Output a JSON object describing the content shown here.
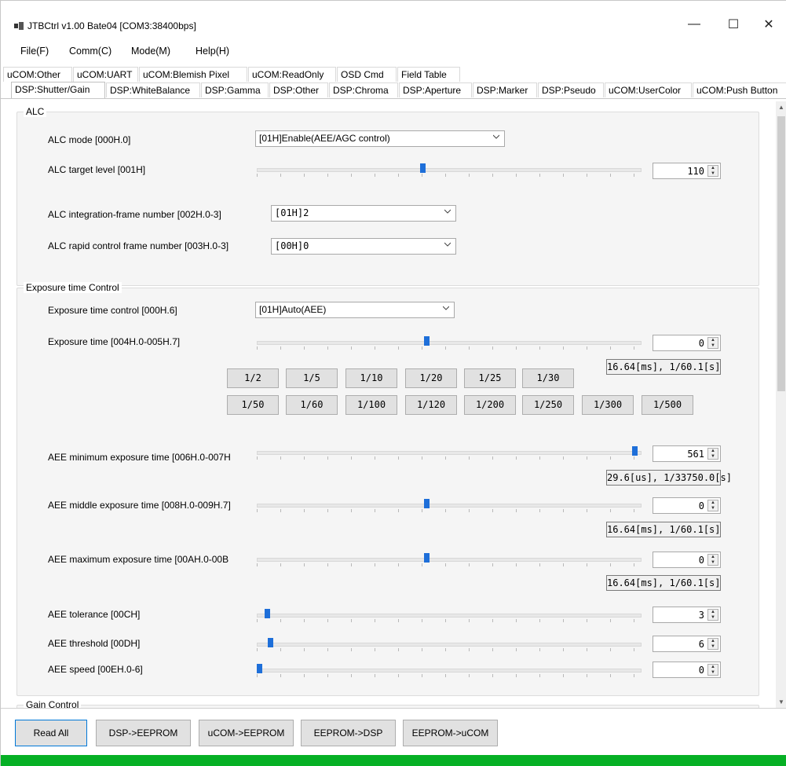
{
  "window": {
    "title": "JTBCtrl v1.00 Bate04 [COM3:38400bps]",
    "minimize": "—",
    "maximize": "☐",
    "close": "✕"
  },
  "menu": [
    {
      "label": "File(F)"
    },
    {
      "label": "Comm(C)"
    },
    {
      "label": "Mode(M)"
    },
    {
      "label": "Help(H)"
    }
  ],
  "tabs_row1": [
    "uCOM:Other",
    "uCOM:UART",
    "uCOM:Blemish Pixel",
    "uCOM:ReadOnly",
    "OSD Cmd",
    "Field Table"
  ],
  "tabs_row2": [
    "DSP:Shutter/Gain",
    "DSP:WhiteBalance",
    "DSP:Gamma",
    "DSP:Other",
    "DSP:Chroma",
    "DSP:Aperture",
    "DSP:Marker",
    "DSP:Pseudo",
    "uCOM:UserColor",
    "uCOM:Push Button"
  ],
  "alc": {
    "title": "ALC",
    "mode_label": "ALC mode [000H.0]",
    "mode_value": "[01H]Enable(AEE/AGC control)",
    "target_label": "ALC target level [001H]",
    "target_value": "110",
    "target_fraction": 0.43,
    "integration_label": "ALC integration-frame number [002H.0-3]",
    "integration_value": "[01H]2",
    "rapid_label": "ALC rapid control frame number [003H.0-3]",
    "rapid_value": "[00H]0"
  },
  "exposure": {
    "title": "Exposure time Control",
    "control_label": "Exposure time control [000H.6]",
    "control_value": "[01H]Auto(AEE)",
    "time_label": "Exposure time [004H.0-005H.7]",
    "time_value": "0",
    "time_fraction": 0.44,
    "time_readout": "16.64[ms], 1/60.1[s]",
    "buttons_row1": [
      "1/2",
      "1/5",
      "1/10",
      "1/20",
      "1/25",
      "1/30"
    ],
    "buttons_row2": [
      "1/50",
      "1/60",
      "1/100",
      "1/120",
      "1/200",
      "1/250",
      "1/300",
      "1/500"
    ],
    "aee_min_label": "AEE minimum exposure time [006H.0-007H",
    "aee_min_value": "561",
    "aee_min_fraction": 0.99,
    "aee_min_readout": "29.6[us], 1/33750.0[s]",
    "aee_mid_label": "AEE middle exposure time [008H.0-009H.7]",
    "aee_mid_value": "0",
    "aee_mid_fraction": 0.44,
    "aee_mid_readout": "16.64[ms], 1/60.1[s]",
    "aee_max_label": "AEE maximum exposure time [00AH.0-00B",
    "aee_max_value": "0",
    "aee_max_fraction": 0.44,
    "aee_max_readout": "16.64[ms], 1/60.1[s]",
    "tolerance_label": "AEE tolerance [00CH]",
    "tolerance_value": "3",
    "tolerance_fraction": 0.02,
    "threshold_label": "AEE threshold [00DH]",
    "threshold_value": "6",
    "threshold_fraction": 0.03,
    "speed_label": "AEE speed [00EH.0-6]",
    "speed_value": "0",
    "speed_fraction": 0.0
  },
  "gain": {
    "title": "Gain Control"
  },
  "bottom_buttons": [
    "Read All",
    "DSP->EEPROM",
    "uCOM->EEPROM",
    "EEPROM->DSP",
    "EEPROM->uCOM"
  ]
}
